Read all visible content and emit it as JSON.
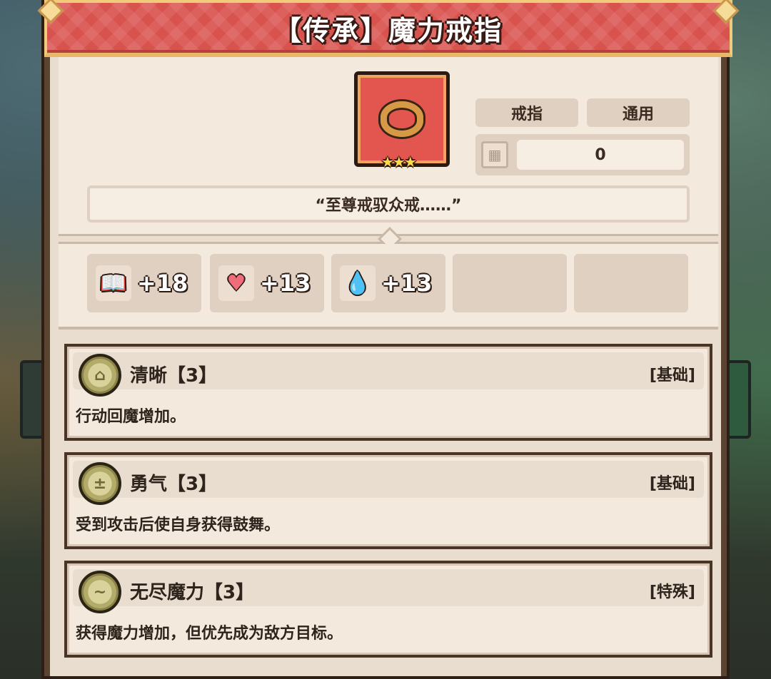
{
  "title": "【传承】魔力戒指",
  "item": {
    "icon": "ring-icon",
    "stars": "★★★",
    "tags": [
      "戒指",
      "通用"
    ],
    "value": "0",
    "quote": "“至尊戒驭众戒……”"
  },
  "stats": [
    {
      "icon": "book-icon",
      "glyph": "📖",
      "value": "+18"
    },
    {
      "icon": "heart-icon",
      "glyph": "♥",
      "value": "+13"
    },
    {
      "icon": "water-drop-icon",
      "glyph": "💧",
      "value": "+13"
    },
    {
      "icon": "",
      "glyph": "",
      "value": ""
    },
    {
      "icon": "",
      "glyph": "",
      "value": ""
    }
  ],
  "skills": [
    {
      "name": "清晰【3】",
      "type": "[基础]",
      "desc": "行动回魔增加。",
      "coin": "⌂"
    },
    {
      "name": "勇气【3】",
      "type": "[基础]",
      "desc": "受到攻击后使自身获得鼓舞。",
      "coin": "±"
    },
    {
      "name": "无尽魔力【3】",
      "type": "[特殊]",
      "desc": "获得魔力增加，但优先成为敌方目标。",
      "coin": "~"
    }
  ],
  "colors": {
    "title_bar": "#d9534e",
    "panel_bg": "#e9ddd0",
    "frame": "#5c4432",
    "item_bg": "#e2564f",
    "coin": "#b3ab6a"
  }
}
